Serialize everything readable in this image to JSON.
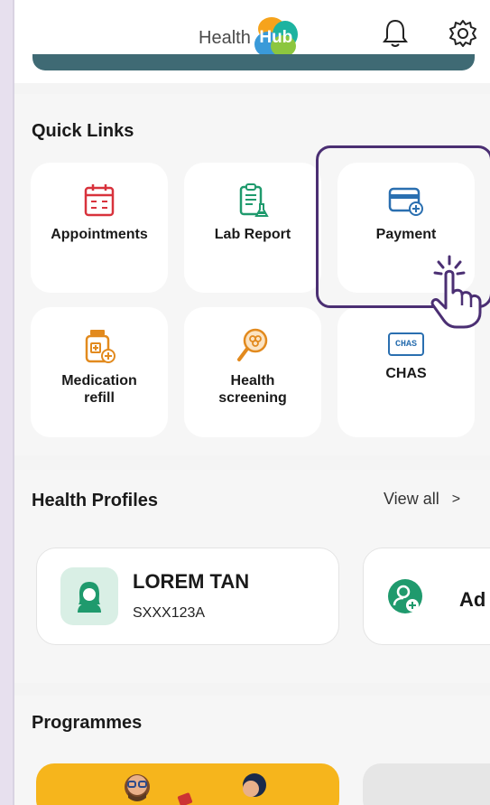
{
  "header": {
    "logo_text": "Health",
    "logo_badge": "Hub",
    "bell_icon": "bell-icon",
    "settings_icon": "gear-icon"
  },
  "quick_links": {
    "title": "Quick Links",
    "items": [
      {
        "label": "Appointments",
        "icon": "calendar-icon"
      },
      {
        "label": "Lab Report",
        "icon": "lab-report-icon"
      },
      {
        "label": "Payment",
        "icon": "credit-card-icon"
      },
      {
        "label": "Medication\nrefill",
        "icon": "medicine-bottle-icon"
      },
      {
        "label": "Health\nscreening",
        "icon": "screening-icon"
      },
      {
        "label": "CHAS",
        "icon": "chas-card-icon"
      }
    ],
    "chas_badge": "CHAS"
  },
  "health_profiles": {
    "title": "Health Profiles",
    "view_all": "View all",
    "view_all_arrow": ">",
    "profiles": [
      {
        "name": "LOREM TAN",
        "id": "SXXX123A"
      },
      {
        "name": "Ad",
        "id": ""
      }
    ]
  },
  "programmes": {
    "title": "Programmes"
  },
  "colors": {
    "accent": "#4b2f73",
    "icon_red": "#d8323c",
    "icon_green": "#1f9a6d",
    "icon_blue": "#2a6fb0",
    "icon_orange": "#e28a1e",
    "banner": "#3f6a74",
    "programme_yellow": "#f6b51c"
  }
}
